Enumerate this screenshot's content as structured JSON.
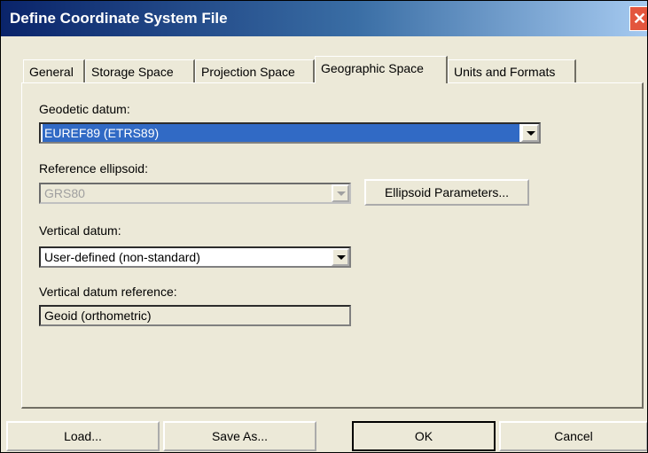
{
  "window": {
    "title": "Define Coordinate System File",
    "close_label": "✕"
  },
  "tabs": [
    {
      "label": "General"
    },
    {
      "label": "Storage Space"
    },
    {
      "label": "Projection Space"
    },
    {
      "label": "Geographic Space",
      "active": true
    },
    {
      "label": "Units and Formats"
    }
  ],
  "geodetic_datum": {
    "label": "Geodetic datum:",
    "value": "EUREF89 (ETRS89)"
  },
  "reference_ellipsoid": {
    "label": "Reference ellipsoid:",
    "value": "GRS80",
    "disabled": true
  },
  "ellipsoid_button": {
    "label": "Ellipsoid Parameters..."
  },
  "vertical_datum": {
    "label": "Vertical datum:",
    "value": "User-defined (non-standard)"
  },
  "vertical_datum_reference": {
    "label": "Vertical datum reference:",
    "value": "Geoid (orthometric)"
  },
  "buttons": {
    "load": "Load...",
    "save_as": "Save As...",
    "ok": "OK",
    "cancel": "Cancel"
  },
  "colors": {
    "titlebar": "#0a246a",
    "selection": "#316ac5",
    "close": "#e3553d",
    "face": "#ece9d8"
  }
}
